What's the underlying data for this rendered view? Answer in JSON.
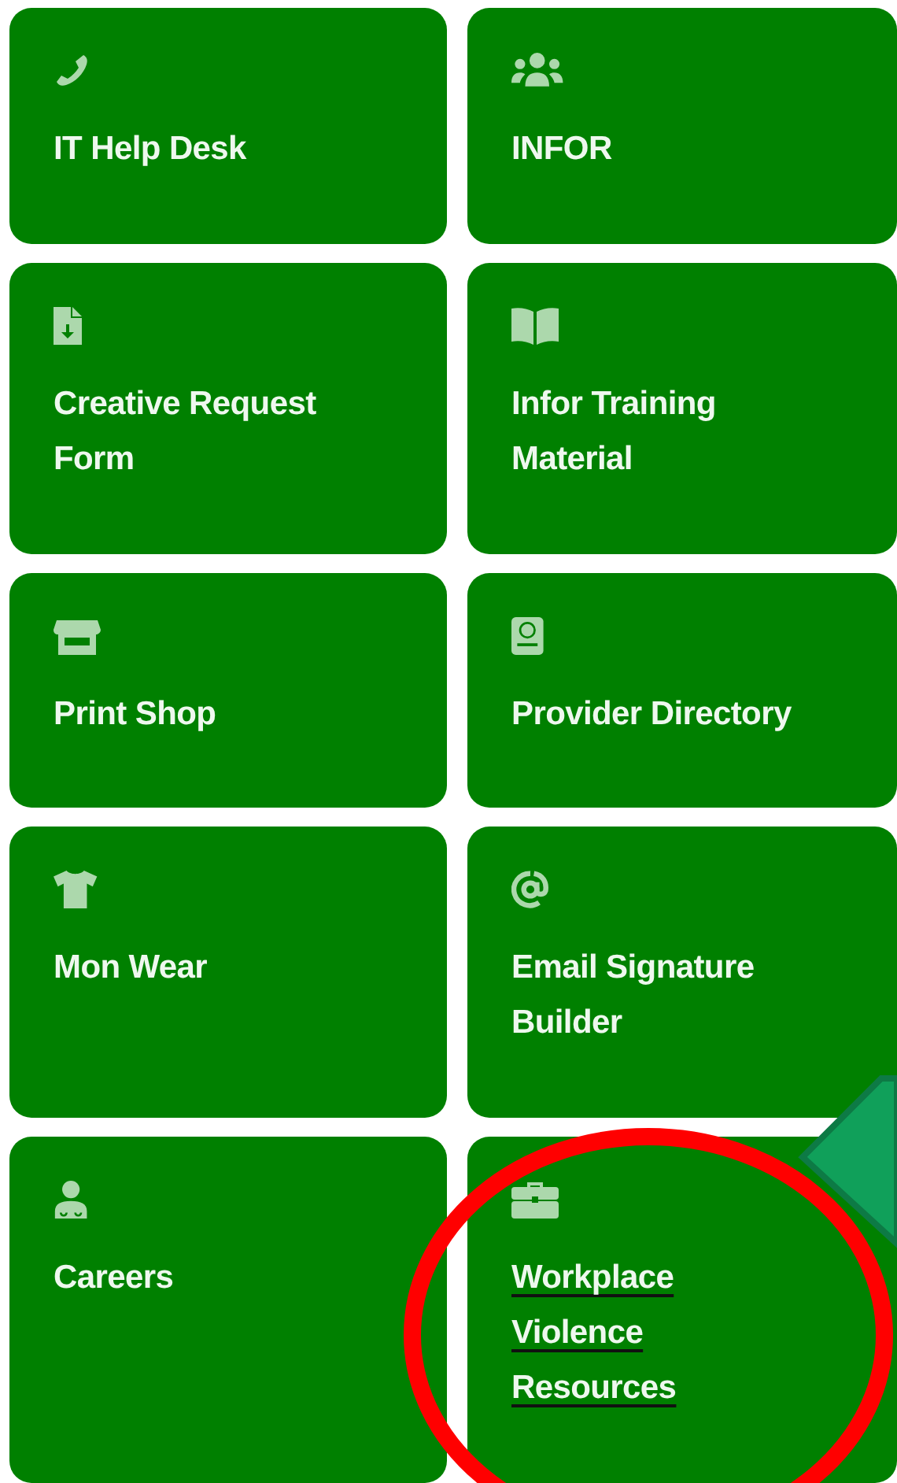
{
  "tiles": [
    {
      "kind": "phone",
      "label": "IT Help Desk",
      "hovered": false
    },
    {
      "kind": "users",
      "label": "INFOR",
      "hovered": false
    },
    {
      "kind": "file",
      "label": "Creative Request Form",
      "hovered": false
    },
    {
      "kind": "book",
      "label": "Infor Training Material",
      "hovered": false
    },
    {
      "kind": "store",
      "label": "Print Shop",
      "hovered": false
    },
    {
      "kind": "directory",
      "label": "Provider Directory",
      "hovered": false
    },
    {
      "kind": "apparel",
      "label": "Mon Wear",
      "hovered": false
    },
    {
      "kind": "email",
      "label": "Email Signature Builder",
      "hovered": false
    },
    {
      "kind": "careers",
      "label": "Careers",
      "hovered": false
    },
    {
      "kind": "briefcase",
      "label": "Workplace Violence Resources",
      "hovered": true
    }
  ],
  "annotations": [
    {
      "kind": "circle",
      "color": "#ff0000"
    },
    {
      "kind": "arrow",
      "color": "#10a05a"
    }
  ]
}
